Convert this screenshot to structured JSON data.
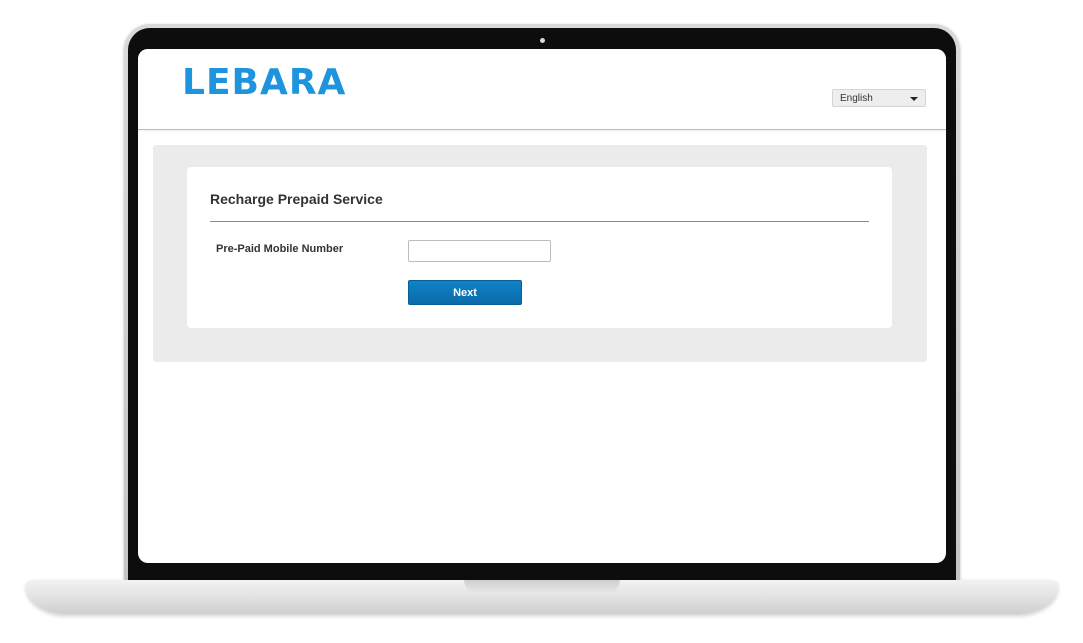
{
  "header": {
    "logo_text": "LEBARA",
    "language": {
      "selected": "English"
    }
  },
  "recharge_form": {
    "title": "Recharge Prepaid Service",
    "mobile_number": {
      "label": "Pre-Paid Mobile Number",
      "value": "",
      "placeholder": ""
    },
    "next_label": "Next"
  },
  "icons": {
    "language_dropdown": "chevron-down-icon"
  },
  "colors": {
    "brand": "#1d94dd",
    "button": "#0f83c8",
    "panel_background": "#ebebeb"
  }
}
